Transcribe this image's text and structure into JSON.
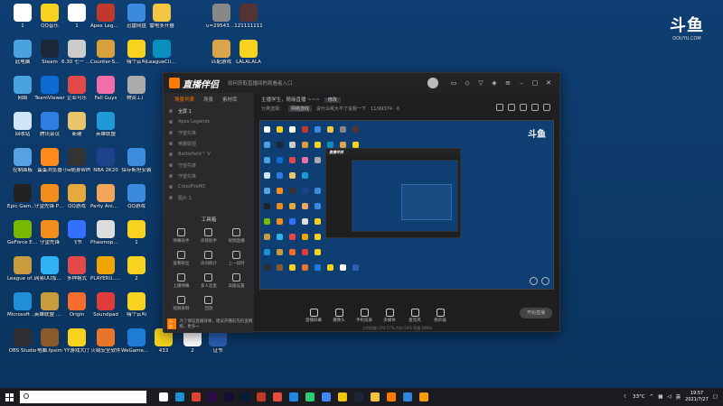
{
  "desktop": {
    "icons": [
      {
        "label": "1",
        "color": "#ffffff"
      },
      {
        "label": "QQ音乐",
        "color": "#f7d21e"
      },
      {
        "label": "1",
        "color": "#ffffff"
      },
      {
        "label": "Apex Legends",
        "color": "#c0392b"
      },
      {
        "label": "迅雷网盘",
        "color": "#3a8be0"
      },
      {
        "label": "雷电多开器",
        "color": "#f4c542"
      },
      {
        "label": "u=295431...",
        "color": "#888888"
      },
      {
        "label": "121111111",
        "color": "#553333"
      },
      {
        "label": "此电脑",
        "color": "#4aa3df"
      },
      {
        "label": "Steam",
        "color": "#1b2838"
      },
      {
        "label": "6.30 七一 第十八季度",
        "color": "#cccccc"
      },
      {
        "label": "Counter-Strike Global Off...",
        "color": "#d6a13b"
      },
      {
        "label": "嗨个云叫",
        "color": "#f7d21e"
      },
      {
        "label": "LeagueCli... - 快捷方式",
        "color": "#0a8fbe"
      },
      {
        "label": "匹配游戏",
        "color": "#d9a44a"
      },
      {
        "label": "LALALALA",
        "color": "#f7d21e"
      },
      {
        "label": "网络",
        "color": "#4aa3df"
      },
      {
        "label": "TeamViewer",
        "color": "#0e6bd1"
      },
      {
        "label": "企业可乐",
        "color": "#e24a4a"
      },
      {
        "label": "Fall Guys",
        "color": "#f06fa8"
      },
      {
        "label": "物资工厂",
        "color": "#aaaaaa"
      },
      {
        "label": "回收站",
        "color": "#cfe6f7"
      },
      {
        "label": "腾讯会议",
        "color": "#2e7de1"
      },
      {
        "label": "新建",
        "color": "#e9c46a"
      },
      {
        "label": "英雄联盟",
        "color": "#1f9ad6"
      },
      {
        "label": "控制面板",
        "color": "#57a1e1"
      },
      {
        "label": "蛋蛋浏览器",
        "color": "#ff8c1a"
      },
      {
        "label": "小e随身WiFi",
        "color": "#333333"
      },
      {
        "label": "NBA 2K20",
        "color": "#1d428a"
      },
      {
        "label": "保存斯坦安装",
        "color": "#3c8dde"
      },
      {
        "label": "Epic Games Launcher",
        "color": "#222222"
      },
      {
        "label": "守望先锋 Public Test",
        "color": "#f28c1a"
      },
      {
        "label": "QQ游戏",
        "color": "#e8a93c"
      },
      {
        "label": "Party Animals",
        "color": "#f2a65a"
      },
      {
        "label": "QQ游戏",
        "color": "#3a8be0"
      },
      {
        "label": "GeForce Experience",
        "color": "#76b900"
      },
      {
        "label": "守望先锋",
        "color": "#f28c1a"
      },
      {
        "label": "飞书",
        "color": "#3370ff"
      },
      {
        "label": "Phasmophobia",
        "color": "#dddddd"
      },
      {
        "label": "1",
        "color": "#f7d21e"
      },
      {
        "label": "League of Legends",
        "color": "#c89b3c"
      },
      {
        "label": "网易UU加速器",
        "color": "#2fb2f2"
      },
      {
        "label": "多种格式",
        "color": "#e24a4a"
      },
      {
        "label": "PLAYERU... BATTLEGR...",
        "color": "#f0a500"
      },
      {
        "label": "2",
        "color": "#f7d21e"
      },
      {
        "label": "Microsoft Edge",
        "color": "#1f8fd6"
      },
      {
        "label": "英雄联盟 WeGame版",
        "color": "#c89b3c"
      },
      {
        "label": "Origin",
        "color": "#f56c2d"
      },
      {
        "label": "Soundpad",
        "color": "#e03b3b"
      },
      {
        "label": "嗨个云叫",
        "color": "#f7d21e"
      },
      {
        "label": "OBS Studio",
        "color": "#302e31"
      },
      {
        "label": "电脑.fpsim",
        "color": "#8b5a2b"
      },
      {
        "label": "YY游戏大厅",
        "color": "#f7d21e"
      },
      {
        "label": "火绒安全软件",
        "color": "#e8762a"
      },
      {
        "label": "WeGame游戏平台",
        "color": "#1f7cd6"
      },
      {
        "label": "433",
        "color": "#f7d21e"
      },
      {
        "label": "2",
        "color": "#ffffff"
      },
      {
        "label": "证书",
        "color": "#2b5fb3"
      }
    ],
    "watermark": {
      "mark": "斗鱼",
      "sub": "DOUYU.COM"
    }
  },
  "app": {
    "name": "直播伴侣",
    "announcement": "如何获取直播间的观看者入口",
    "sidebar": {
      "tabs": [
        "场景列表",
        "场景",
        "素材库"
      ],
      "scenes": [
        "全屏 1",
        "Apex Legends",
        "守望先锋",
        "英雄联盟",
        "Battlefield™ V",
        "守望先锋",
        "守望先锋",
        "CrossFireHD",
        "图片 1"
      ],
      "tools_title": "工具箱",
      "tools": [
        "弹幕助手",
        "房管助手",
        "视频直播",
        "查看粉丝",
        "房间统计",
        "上一段时",
        "上播弹幕",
        "多人连麦",
        "高级设置",
        "视频录制",
        "回放"
      ],
      "notice_tag": "公告",
      "notice": "为了保证直播效果，建议开播前先检查网络，更多→"
    },
    "room": {
      "title": "主播学生，随缘直播 ~~~",
      "title_btn": "修改",
      "category_label": "分类选择：",
      "category": "网络游戏",
      "meta_text": "说什么呢大不了说我一下",
      "viewers": "11/99374",
      "likes": "6"
    },
    "preview": {
      "logo": "斗鱼"
    },
    "nested_title": "直播伴侣",
    "bottom_tools": [
      "直播屏幕",
      "摄像头",
      "手机投屏",
      "多媒体",
      "麦克风",
      "扬声器"
    ],
    "live_button": "开始直播",
    "status_text": "主机性能  CPU:17%  内存:54%  网速:0KB/s"
  },
  "taskbar": {
    "temperature": "33°C",
    "time": "19:57",
    "date": "2021/7/27",
    "pinned": [
      {
        "name": "task-view",
        "color": "#ffffff"
      },
      {
        "name": "edge",
        "color": "#1f8fd6"
      },
      {
        "name": "chrome",
        "color": "#e34234"
      },
      {
        "name": "premiere",
        "color": "#2a0a4a"
      },
      {
        "name": "after-effects",
        "color": "#1a0a3a"
      },
      {
        "name": "photoshop",
        "color": "#0a1a3a"
      },
      {
        "name": "netease",
        "color": "#c0392b"
      },
      {
        "name": "music",
        "color": "#e74c3c"
      },
      {
        "name": "qq",
        "color": "#1e88e5"
      },
      {
        "name": "wechat",
        "color": "#2ecc71"
      },
      {
        "name": "google",
        "color": "#4285f4"
      },
      {
        "name": "wegame",
        "color": "#f1c40f"
      },
      {
        "name": "steam",
        "color": "#1b2838"
      },
      {
        "name": "explorer",
        "color": "#f4c542"
      },
      {
        "name": "livemate",
        "color": "#ff7a00"
      },
      {
        "name": "app-blue",
        "color": "#2e86de"
      },
      {
        "name": "app-orange",
        "color": "#f39c12"
      }
    ]
  }
}
